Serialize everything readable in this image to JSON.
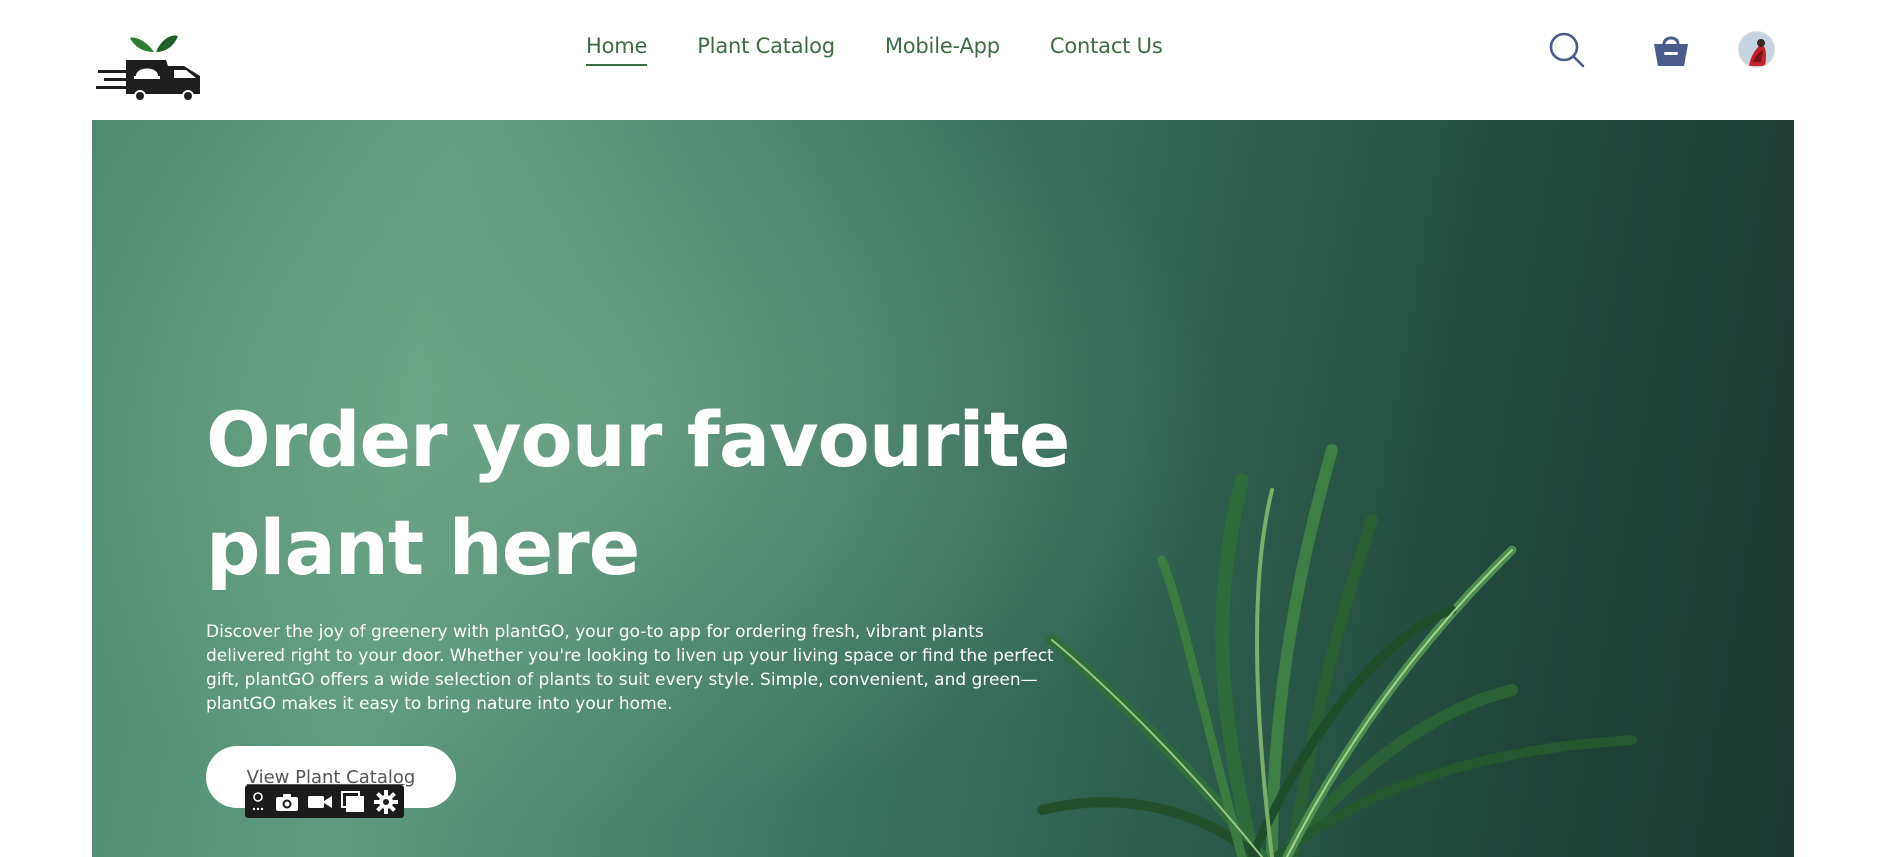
{
  "brand": {
    "logo_icon": "plant-delivery-truck-logo"
  },
  "nav": {
    "items": [
      {
        "label": "Home",
        "active": true
      },
      {
        "label": "Plant Catalog",
        "active": false
      },
      {
        "label": "Mobile-App",
        "active": false
      },
      {
        "label": "Contact Us",
        "active": false
      }
    ]
  },
  "header_icons": {
    "search": "search-icon",
    "cart": "basket-icon",
    "avatar": "user-avatar"
  },
  "hero": {
    "title": "Order your favourite plant here",
    "description": "Discover the joy of greenery with plantGO, your go-to app for ordering fresh, vibrant plants delivered right to your door. Whether you're looking to liven up your living space or find the perfect gift, plantGO offers a wide selection of plants to suit every style. Simple, convenient, and green—plantGO makes it easy to bring nature into your home.",
    "cta_label": "View Plant Catalog"
  },
  "overlay_toolbar": {
    "icons": [
      "link-icon",
      "camera-icon",
      "video-icon",
      "window-icon",
      "gear-icon"
    ]
  },
  "colors": {
    "nav_text": "#3f6b47",
    "hero_green": "#4d8a70",
    "hero_dark": "#1c3a31",
    "cart_icon": "#4b5b8c"
  }
}
